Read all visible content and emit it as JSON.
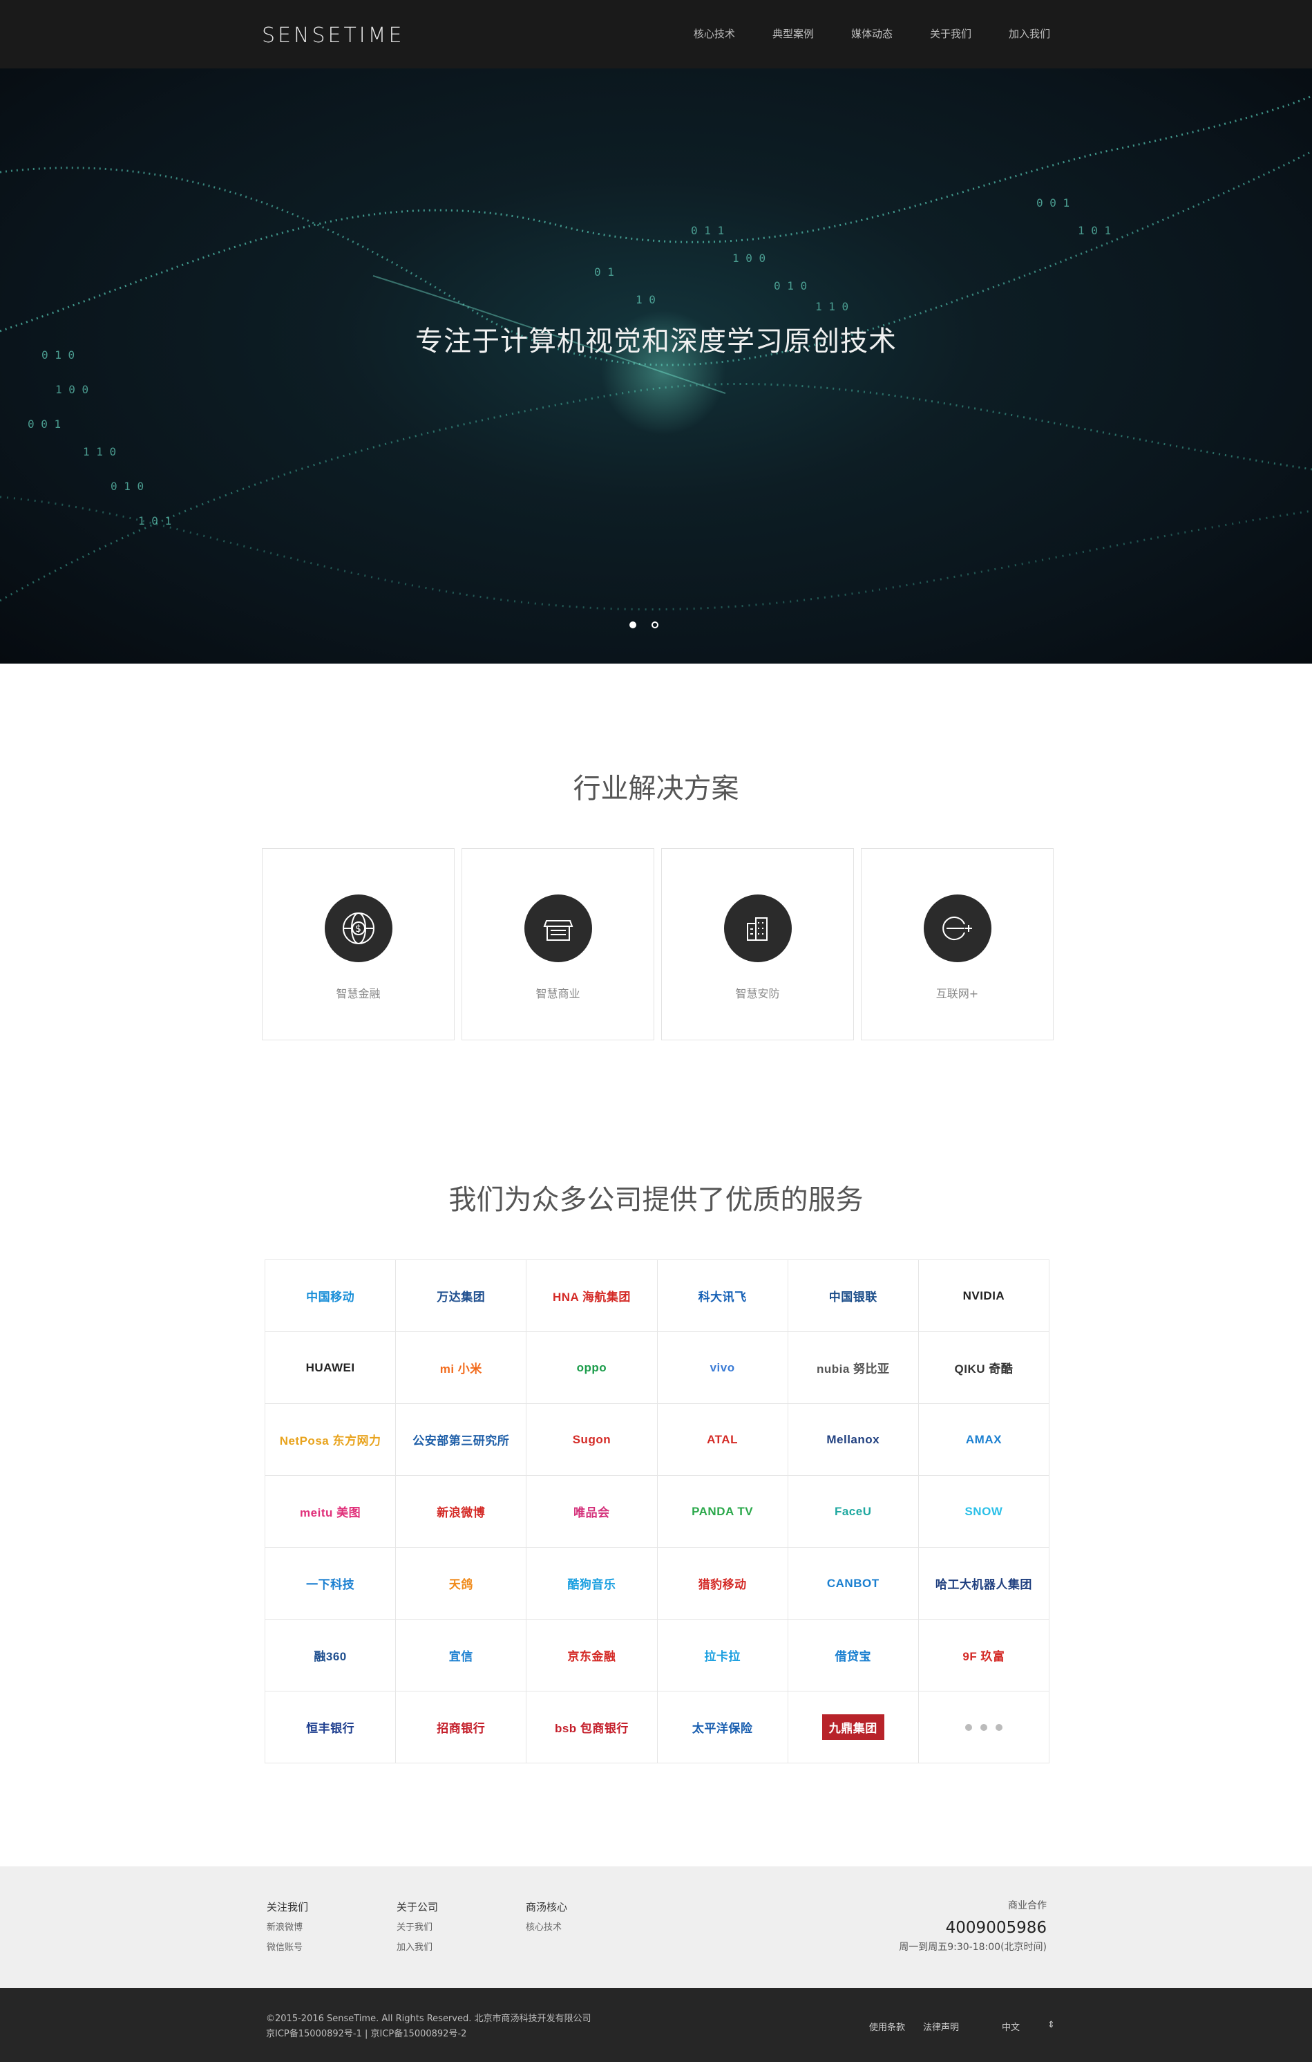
{
  "header": {
    "logo": "SENSETIME",
    "nav": [
      "核心技术",
      "典型案例",
      "媒体动态",
      "关于我们",
      "加入我们"
    ]
  },
  "hero": {
    "title": "专注于计算机视觉和深度学习原创技术",
    "slides": 2,
    "active_slide": 1
  },
  "solutions": {
    "title": "行业解决方案",
    "items": [
      {
        "label": "智慧金融",
        "icon": "globe-dollar-icon"
      },
      {
        "label": "智慧商业",
        "icon": "storefront-icon"
      },
      {
        "label": "智慧安防",
        "icon": "buildings-icon"
      },
      {
        "label": "互联网+",
        "icon": "e-plus-icon"
      }
    ]
  },
  "partners": {
    "title": "我们为众多公司提供了优质的服务",
    "logos": [
      {
        "text": "中国移动",
        "color": "#1a8fd8"
      },
      {
        "text": "万达集团",
        "color": "#1f4f8f"
      },
      {
        "text": "HNA 海航集团",
        "color": "#d42a26"
      },
      {
        "text": "科大讯飞",
        "color": "#1560b5"
      },
      {
        "text": "中国银联",
        "color": "#1c4e8a"
      },
      {
        "text": "NVIDIA",
        "color": "#222222"
      },
      {
        "text": "HUAWEI",
        "color": "#222222"
      },
      {
        "text": "mi 小米",
        "color": "#f26a1b"
      },
      {
        "text": "oppo",
        "color": "#1a9c4a"
      },
      {
        "text": "vivo",
        "color": "#3a7bd5"
      },
      {
        "text": "nubia 努比亚",
        "color": "#555555"
      },
      {
        "text": "QIKU 奇酷",
        "color": "#333333"
      },
      {
        "text": "NetPosa 东方网力",
        "color": "#e8a31d"
      },
      {
        "text": "公安部第三研究所",
        "color": "#1f5fa8"
      },
      {
        "text": "Sugon",
        "color": "#d42a26"
      },
      {
        "text": "ATAL",
        "color": "#d42a26"
      },
      {
        "text": "Mellanox",
        "color": "#1f3f7f"
      },
      {
        "text": "AMAX",
        "color": "#1a7fd0"
      },
      {
        "text": "meitu 美图",
        "color": "#e0307a"
      },
      {
        "text": "新浪微博",
        "color": "#d42a26"
      },
      {
        "text": "唯品会",
        "color": "#d4307a"
      },
      {
        "text": "PANDA TV",
        "color": "#2aa84a"
      },
      {
        "text": "FaceU",
        "color": "#1fa8a0"
      },
      {
        "text": "SNOW",
        "color": "#2cc0e8"
      },
      {
        "text": "一下科技",
        "color": "#1a7fd0"
      },
      {
        "text": "天鸽",
        "color": "#f08a1a"
      },
      {
        "text": "酷狗音乐",
        "color": "#1a9fe0"
      },
      {
        "text": "猎豹移动",
        "color": "#d42a26"
      },
      {
        "text": "CANBOT",
        "color": "#1a7fd0"
      },
      {
        "text": "哈工大机器人集团",
        "color": "#1f3f7f"
      },
      {
        "text": "融360",
        "color": "#1f4f8f"
      },
      {
        "text": "宜信",
        "color": "#1a7fd0"
      },
      {
        "text": "京东金融",
        "color": "#d42a26"
      },
      {
        "text": "拉卡拉",
        "color": "#1a9fe0"
      },
      {
        "text": "借贷宝",
        "color": "#1a7fd0"
      },
      {
        "text": "9F 玖富",
        "color": "#d42a26"
      },
      {
        "text": "恒丰银行",
        "color": "#1f3f8f"
      },
      {
        "text": "招商银行",
        "color": "#c41e2a"
      },
      {
        "text": "bsb 包商银行",
        "color": "#c41e2a"
      },
      {
        "text": "太平洋保险",
        "color": "#1a5fb0"
      },
      {
        "text": "九鼎集团",
        "color": "#ffffff",
        "bg": "#b8232a"
      },
      {
        "text": "",
        "more": true
      }
    ]
  },
  "footer": {
    "cols": [
      {
        "title": "关注我们",
        "links": [
          "新浪微博",
          "微信账号"
        ]
      },
      {
        "title": "关于公司",
        "links": [
          "关于我们",
          "加入我们"
        ]
      },
      {
        "title": "商汤核心",
        "links": [
          "核心技术"
        ]
      }
    ],
    "contact_title": "商业合作",
    "phone": "4009005986",
    "hours": "周一到周五9:30-18:00(北京时间)"
  },
  "bottom": {
    "copyright": "©2015-2016 SenseTime. All Rights Reserved. 北京市商汤科技开发有限公司",
    "icp": "京ICP备15000892号-1 | 京ICP备15000892号-2",
    "links": [
      "使用条款",
      "法律声明"
    ],
    "lang": "中文",
    "lang_arrow": "⇕"
  }
}
